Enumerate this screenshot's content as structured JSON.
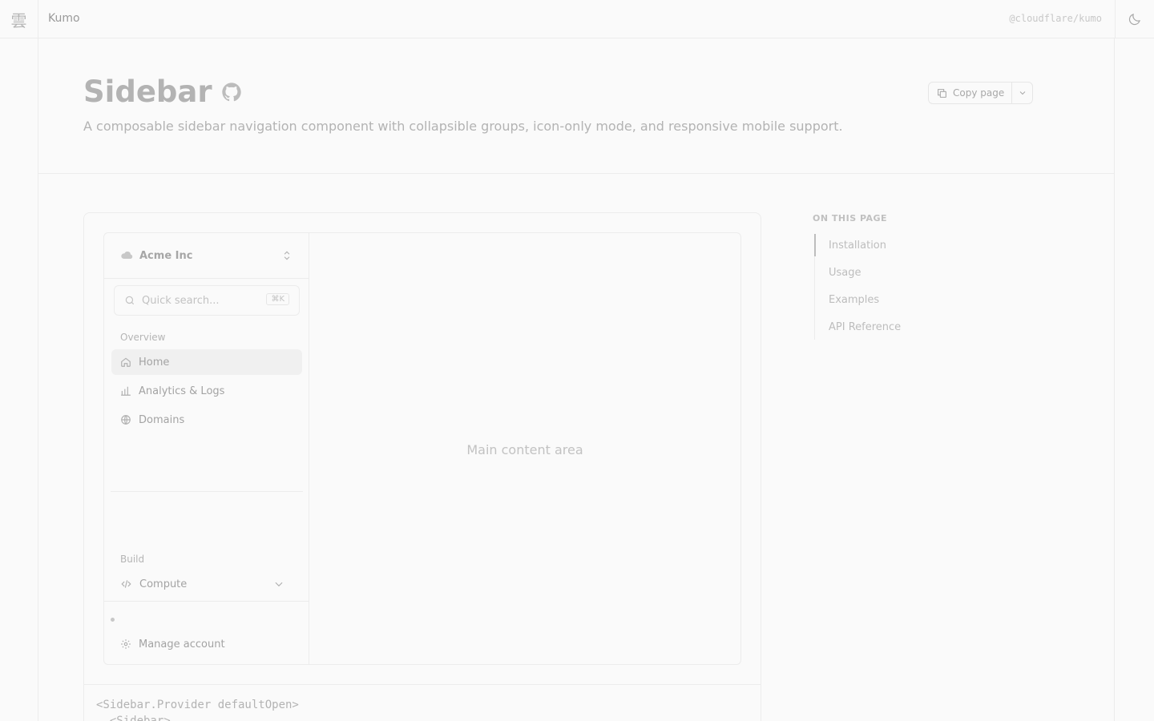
{
  "topbar": {
    "logo_glyph": "雲",
    "brand": "Kumo",
    "package": "@cloudflare/kumo",
    "theme_icon": "moon-icon"
  },
  "header": {
    "title": "Sidebar",
    "title_icon": "github-icon",
    "description": "A composable sidebar navigation component with collapsible groups, icon-only mode, and responsive mobile support.",
    "copy_label": "Copy page"
  },
  "demo": {
    "org": "Acme Inc",
    "search_placeholder": "Quick search...",
    "search_shortcut": "⌘K",
    "groups": {
      "overview": "Overview",
      "build": "Build"
    },
    "nav": {
      "home": "Home",
      "analytics": "Analytics & Logs",
      "domains": "Domains",
      "compute": "Compute",
      "manage": "Manage account"
    },
    "main_content": "Main content area"
  },
  "code": {
    "line1": "<Sidebar.Provider defaultOpen>",
    "line2": "  <Sidebar>"
  },
  "toc": {
    "title": "ON THIS PAGE",
    "items": [
      "Installation",
      "Usage",
      "Examples",
      "API Reference"
    ]
  },
  "colors": {
    "background": "#fafafa",
    "border": "#ececec",
    "text_muted": "#a3a3a3"
  }
}
